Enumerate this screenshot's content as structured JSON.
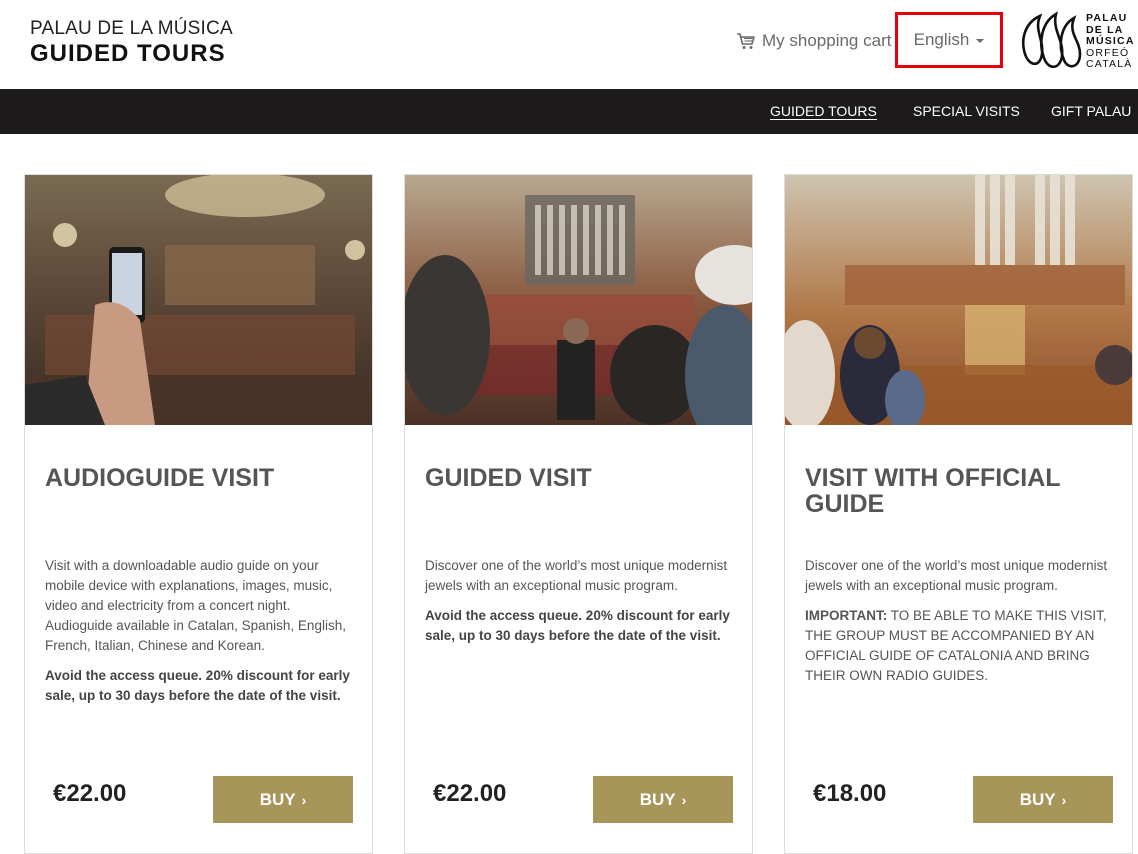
{
  "header": {
    "brand_line1": "PALAU DE LA MÚSICA",
    "brand_line2": "GUIDED TOURS",
    "cart_label": "My shopping cart",
    "cart_icon": "shopping-cart-icon",
    "language": "English",
    "logo_lines": [
      "PALAU",
      "DE LA",
      "MÚSICA",
      "ORFEÓ",
      "CATALÀ"
    ]
  },
  "nav": {
    "items": [
      {
        "label": "GUIDED TOURS",
        "active": true
      },
      {
        "label": "SPECIAL VISITS",
        "active": false
      },
      {
        "label": "GIFT PALAU",
        "active": false
      }
    ]
  },
  "cards": [
    {
      "title": "AUDIOGUIDE VISIT",
      "desc": "Visit with a downloadable audio guide on your mobile device with explanations, images, music, video and electricity from a concert night. Audioguide available in Catalan, Spanish, English, French, Italian, Chinese and Korean.",
      "note": "Avoid the access queue. 20% discount for early sale, up to 30 days before the date of the visit.",
      "price": "€22.00",
      "buy": "BUY"
    },
    {
      "title": "GUIDED VISIT",
      "desc": "Discover one of the world’s most unique modernist jewels with an exceptional music program.",
      "note": "Avoid the access queue. 20% discount for early sale, up to 30 days before the date of the visit.",
      "price": "€22.00",
      "buy": "BUY"
    },
    {
      "title": "VISIT WITH OFFICIAL GUIDE",
      "desc": "Discover one of the world’s most unique modernist jewels with an exceptional music program.",
      "important_label": "IMPORTANT:",
      "important_text": "TO BE ABLE TO MAKE THIS VISIT, THE GROUP MUST BE ACCOMPANIED BY AN OFFICIAL GUIDE OF CATALONIA AND BRING THEIR OWN RADIO GUIDES.",
      "price": "€18.00",
      "buy": "BUY"
    }
  ],
  "colors": {
    "nav_bg": "#1c1a1b",
    "buy_button": "#a8955a",
    "highlight_border": "#e8000b"
  }
}
